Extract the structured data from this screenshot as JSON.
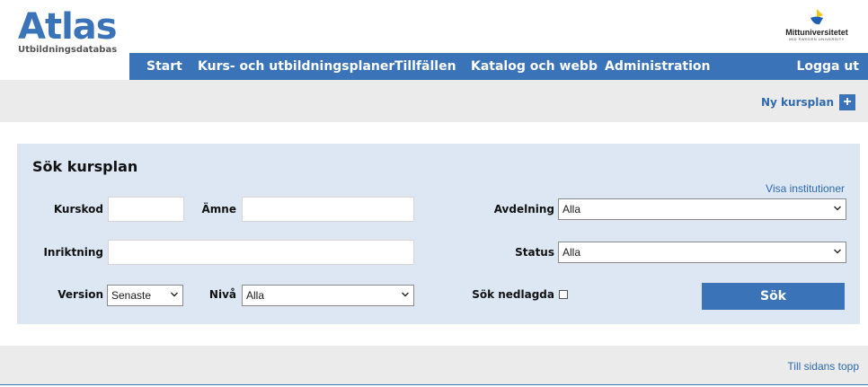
{
  "brand": {
    "title": "Atlas",
    "subtitle": "Utbildningsdatabas",
    "university_name": "Mittuniversitetet",
    "university_tagline": "MID SWEDEN UNIVERSITY",
    "accent_color": "#3a73b8"
  },
  "nav": {
    "items": [
      "Start",
      "Kurs- och utbildningsplaner",
      "Tillfällen",
      "Katalog och webb",
      "Administration"
    ],
    "logout": "Logga ut"
  },
  "toolbar": {
    "new_plan_label": "Ny kursplan",
    "new_plan_icon": "plus-icon"
  },
  "search": {
    "title": "Sök kursplan",
    "show_departments_link": "Visa institutioner",
    "kurskod_label": "Kurskod",
    "kurskod_value": "",
    "amne_label": "Ämne",
    "amne_value": "",
    "inriktning_label": "Inriktning",
    "inriktning_value": "",
    "version_label": "Version",
    "version_selected": "Senaste",
    "niva_label": "Nivå",
    "niva_selected": "Alla",
    "avdelning_label": "Avdelning",
    "avdelning_selected": "Alla",
    "status_label": "Status",
    "status_selected": "Alla",
    "sok_nedlagda_label": "Sök nedlagda",
    "sok_nedlagda_checked": false,
    "submit_label": "Sök"
  },
  "footer": {
    "to_top_link": "Till sidans topp"
  }
}
